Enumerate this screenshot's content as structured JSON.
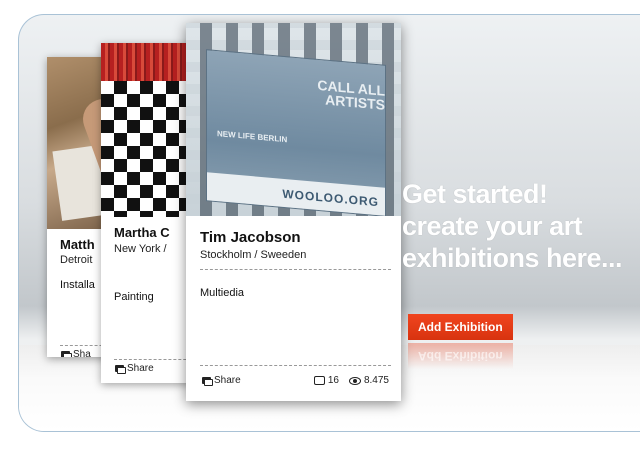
{
  "cards": [
    {
      "name": "Matth",
      "city": "Detroit",
      "category": "Installa",
      "share": "Sha"
    },
    {
      "name": "Martha C",
      "city": "New York /",
      "category": "Painting",
      "share": "Share"
    },
    {
      "name": "Tim Jacobson",
      "city": "Stockholm / Sweeden",
      "category": "Multiedia",
      "share": "Share",
      "comments": "16",
      "views": "8.475",
      "banner_title": "CALL ALL ARTISTS",
      "banner_brand": "WOOLOO.ORG",
      "banner_small": "NEW LIFE BERLIN"
    }
  ],
  "headline": {
    "line1": "Get started!",
    "line2": "create your art",
    "line3": "exhibitions here..."
  },
  "add_button_label": "Add Exhibition",
  "colors": {
    "button": "#e63c19",
    "frame_border": "#a9c2d6"
  }
}
